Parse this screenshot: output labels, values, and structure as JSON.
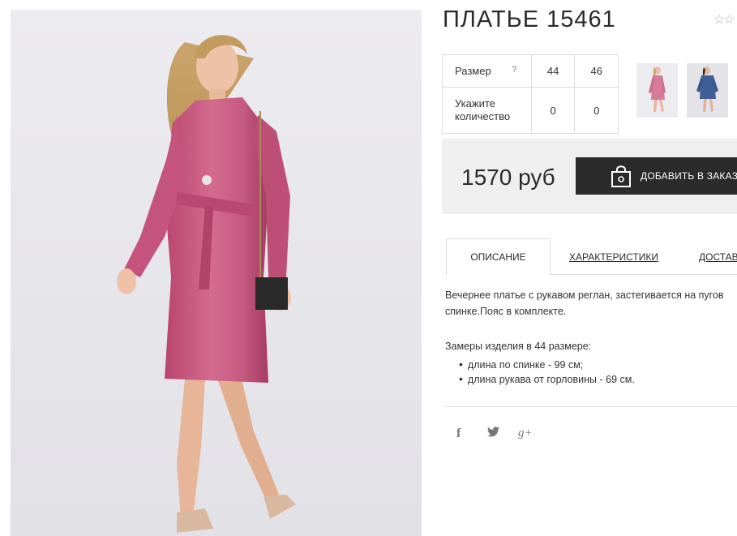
{
  "product": {
    "title": "ПЛАТЬЕ 15461",
    "rating_stars": "☆☆"
  },
  "size_table": {
    "size_label": "Размер",
    "help_icon": "?",
    "sizes": [
      "44",
      "46"
    ],
    "quantity_label": "Укажите количество",
    "quantities": [
      "0",
      "0"
    ]
  },
  "thumbnails": [
    {
      "name": "pink-dress",
      "color": "#c9587f"
    },
    {
      "name": "blue-dress",
      "color": "#3f5f96"
    }
  ],
  "purchase": {
    "price": "1570 руб",
    "add_to_order_label": "ДОБАВИТЬ В ЗАКАЗ"
  },
  "tabs": [
    {
      "label": "ОПИСАНИЕ",
      "active": true
    },
    {
      "label": "ХАРАКТЕРИСТИКИ",
      "active": false
    },
    {
      "label": "ДОСТАВ",
      "active": false
    }
  ],
  "description": {
    "line1": "Вечернее платье с рукавом реглан, застегивается на пугов",
    "line2": "спинке.Пояс в комплекте.",
    "measure_title": "Замеры изделия в 44 размере:",
    "measures": [
      "длина по спинке - 99 см;",
      "длина рукава от горловины - 69 см."
    ]
  },
  "social": {
    "facebook": "f",
    "twitter": "🐦",
    "google_plus": "g+"
  },
  "colors": {
    "dress_pink": "#c9587f",
    "button_dark": "#2b2b2b",
    "price_bg": "#efefef"
  }
}
